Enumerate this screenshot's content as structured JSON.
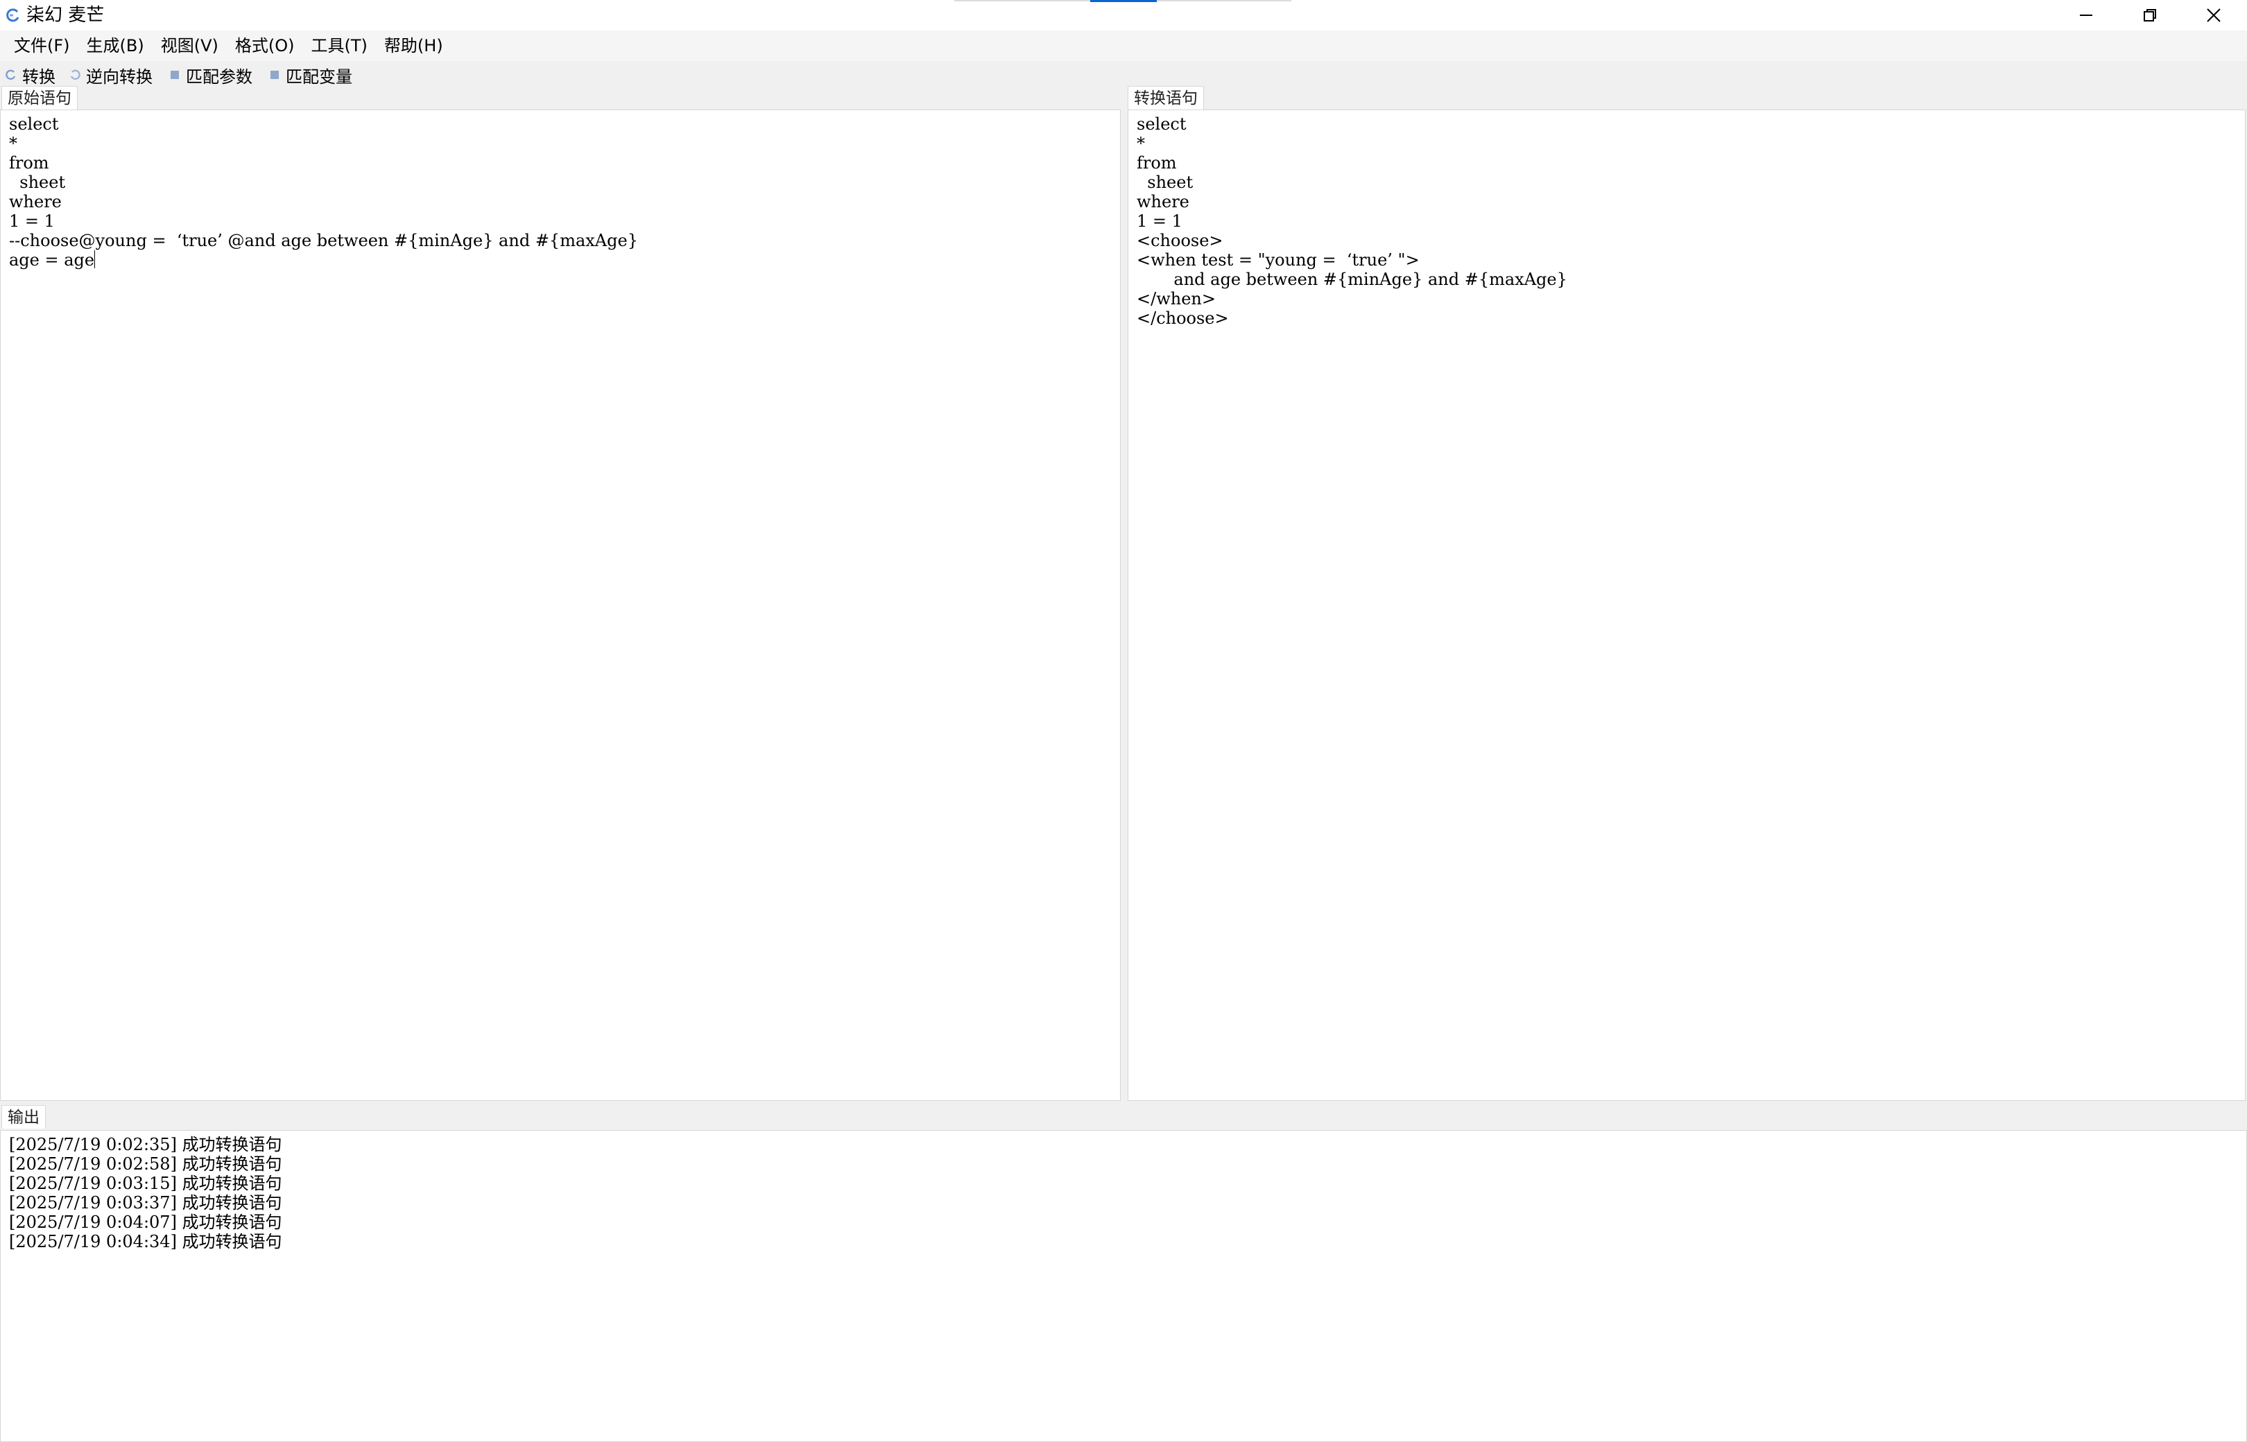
{
  "window": {
    "title": "柒幻 麦芒",
    "minimize_icon": "minimize-icon",
    "restore_icon": "restore-icon",
    "close_icon": "close-icon"
  },
  "menu": {
    "items": [
      "文件(F)",
      "生成(B)",
      "视图(V)",
      "格式(O)",
      "工具(T)",
      "帮助(H)"
    ]
  },
  "toolbar": {
    "convert": "转换",
    "reverse_convert": "逆向转换",
    "match_params": "匹配参数",
    "match_vars": "匹配变量"
  },
  "source_panel": {
    "tab": "原始语句",
    "lines": [
      "select",
      "*",
      "from",
      "  sheet",
      "where",
      "1 = 1",
      "--choose@young =  ‘true’ @and age between #{minAge} and #{maxAge}",
      "age = age"
    ]
  },
  "result_panel": {
    "tab": "转换语句",
    "lines": [
      "select",
      "*",
      "from",
      "  sheet",
      "where",
      "1 = 1",
      "<choose>",
      "<when test = \"young =  ‘true’ \">",
      "       and age between #{minAge} and #{maxAge}",
      "</when>",
      "</choose>"
    ]
  },
  "output_panel": {
    "tab": "输出",
    "lines": [
      "[2025/7/19 0:02:35] 成功转换语句",
      "[2025/7/19 0:02:58] 成功转换语句",
      "[2025/7/19 0:03:15] 成功转换语句",
      "[2025/7/19 0:03:37] 成功转换语句",
      "[2025/7/19 0:04:07] 成功转换语句",
      "[2025/7/19 0:04:34] 成功转换语句"
    ]
  }
}
